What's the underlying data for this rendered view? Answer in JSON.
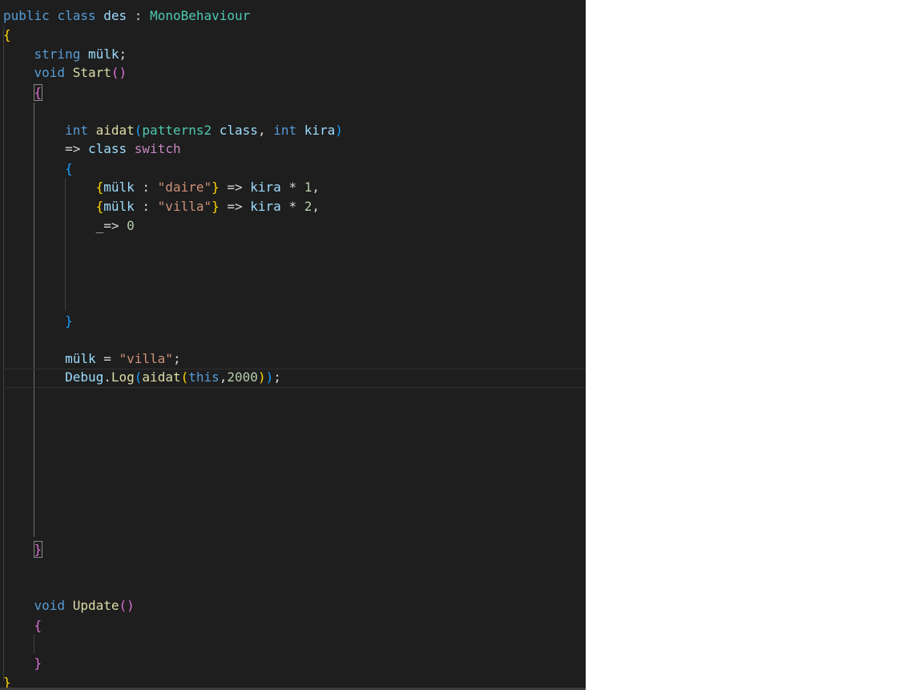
{
  "editor": {
    "language": "C#",
    "theme_colors": {
      "background": "#1e1e1e",
      "keyword": "#569cd6",
      "type": "#4ec9b0",
      "function": "#dcdcaa",
      "variable": "#9cdcfe",
      "string": "#ce9178",
      "number": "#b5cea8",
      "control": "#c586c0",
      "bracket_level1": "#ffd700",
      "bracket_level2": "#da70d6",
      "bracket_level3": "#179fff"
    },
    "code": {
      "l1": {
        "kw_public": "public",
        "kw_class": "class",
        "class_name": "des",
        "colon": " : ",
        "base_type": "MonoBehaviour"
      },
      "l2": {
        "brace": "{"
      },
      "l3": {
        "kw_string": "string",
        "field": "mülk",
        "semi": ";"
      },
      "l4": {
        "kw_void": "void",
        "method": "Start",
        "parens": "()"
      },
      "l5": {
        "brace": "{"
      },
      "l7": {
        "kw_int": "int",
        "func": "aidat",
        "paren_open": "(",
        "param_type": "patterns2",
        "param1": "class",
        "comma": ", ",
        "kw_int2": "int",
        "param2": "kira",
        "paren_close": ")"
      },
      "l8": {
        "arrow": "=>",
        "kw_class": "class",
        "kw_switch": "switch"
      },
      "l9": {
        "brace": "{"
      },
      "l10": {
        "brace_open": "{",
        "prop": "mülk",
        "colon": " : ",
        "value": "\"daire\"",
        "brace_close": "}",
        "arrow": " => ",
        "var": "kira",
        "op": " * ",
        "num": "1",
        "comma": ","
      },
      "l11": {
        "brace_open": "{",
        "prop": "mülk",
        "colon": " : ",
        "value": "\"villa\"",
        "brace_close": "}",
        "arrow": " => ",
        "var": "kira",
        "op": " * ",
        "num": "2",
        "comma": ","
      },
      "l12": {
        "discard": "_=>",
        "num": "0"
      },
      "l17": {
        "brace": "}"
      },
      "l19": {
        "var": "mülk",
        "eq": " = ",
        "value": "\"villa\"",
        "semi": ";"
      },
      "l20": {
        "obj": "Debug",
        "dot": ".",
        "method": "Log",
        "p1": "(",
        "func": "aidat",
        "p2": "(",
        "kw_this": "this",
        "comma": ",",
        "num": "2000",
        "p3": ")",
        "p4": ")",
        "semi": ";"
      },
      "l29": {
        "brace": "}"
      },
      "l32": {
        "kw_void": "void",
        "method": "Update",
        "parens": "()"
      },
      "l33": {
        "brace": "{"
      },
      "l35": {
        "brace": "}"
      },
      "l36": {
        "brace": "}"
      }
    }
  }
}
